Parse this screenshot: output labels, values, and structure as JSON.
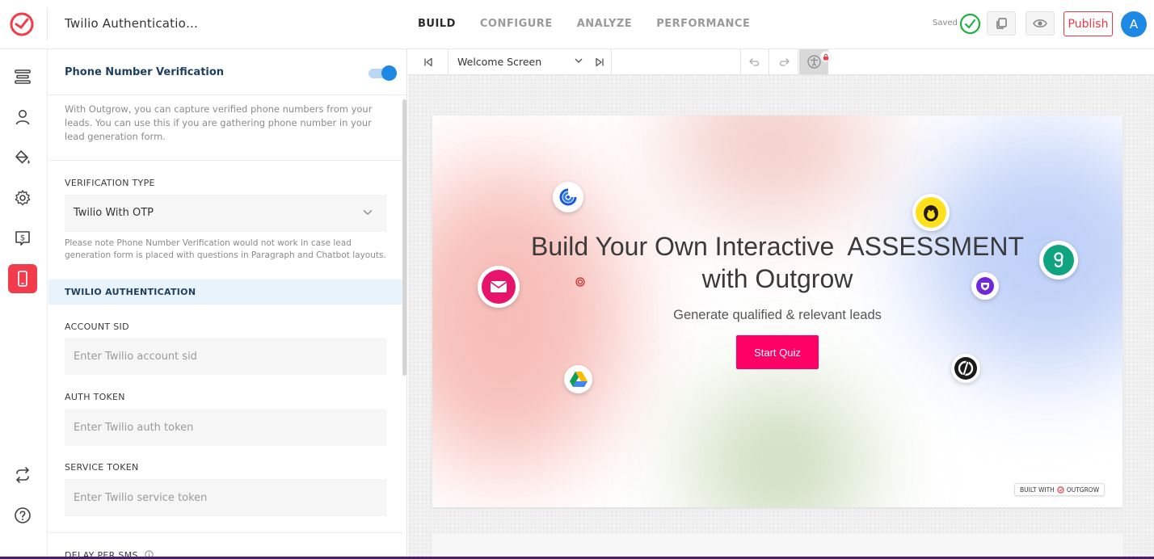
{
  "app": {
    "title": "Twilio Authenticatio…",
    "accent": "#f23b4b"
  },
  "nav": {
    "tabs": [
      {
        "label": "BUILD",
        "active": true
      },
      {
        "label": "CONFIGURE",
        "active": false
      },
      {
        "label": "ANALYZE",
        "active": false
      },
      {
        "label": "PERFORMANCE",
        "active": false
      }
    ]
  },
  "header": {
    "saved_label": "Saved",
    "publish_label": "Publish",
    "avatar_initial": "A"
  },
  "rail": {
    "icons": [
      "layout-icon",
      "user-icon",
      "paint-bucket-icon",
      "gear-icon",
      "dollar-screen-icon",
      "mobile-phone-icon",
      "sync-icon",
      "help-icon"
    ],
    "active": "mobile-phone-icon"
  },
  "panel": {
    "title": "Phone Number Verification",
    "toggle_on": true,
    "description": "With Outgrow, you can capture verified phone numbers from your leads. You can use this if you are gathering phone number in your lead generation form.",
    "verification_type_label": "VERIFICATION TYPE",
    "verification_type_value": "Twilio With OTP",
    "note": "Please note Phone Number Verification would not work in case lead generation form is placed with questions in Paragraph and Chatbot layouts.",
    "section_title": "TWILIO AUTHENTICATION",
    "account_sid_label": "ACCOUNT SID",
    "account_sid_placeholder": "Enter Twilio account sid",
    "auth_token_label": "AUTH TOKEN",
    "auth_token_placeholder": "Enter Twilio auth token",
    "service_token_label": "SERVICE TOKEN",
    "service_token_placeholder": "Enter Twilio service token",
    "delay_label": "DELAY PER SMS"
  },
  "canvas": {
    "screen_selector": "Welcome Screen",
    "headline_line1": "Build Your Own Interactive  ASSESSMENT",
    "headline_line2": "with Outgrow",
    "subheadline": "Generate qualified & relevant leads",
    "cta_label": "Start Quiz",
    "cta_color": "#ff0066",
    "badge_prefix": "BUILT WITH",
    "badge_brand": "OUTGROW"
  }
}
